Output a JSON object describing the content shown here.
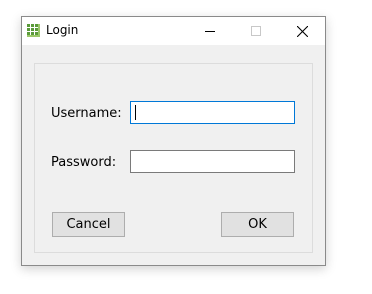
{
  "window": {
    "title": "Login",
    "icon": "grid-app-icon",
    "controls": {
      "minimize_icon": "minimize-icon",
      "maximize_icon": "maximize-icon",
      "close_icon": "close-icon"
    }
  },
  "form": {
    "username_label": "Username:",
    "username_value": "",
    "password_label": "Password:",
    "password_value": "",
    "focused_field": "username"
  },
  "buttons": {
    "cancel_label": "Cancel",
    "ok_label": "OK"
  },
  "colors": {
    "focus_border": "#0078d7",
    "dialog_background": "#f0f0f0",
    "button_background": "#e1e1e1"
  }
}
